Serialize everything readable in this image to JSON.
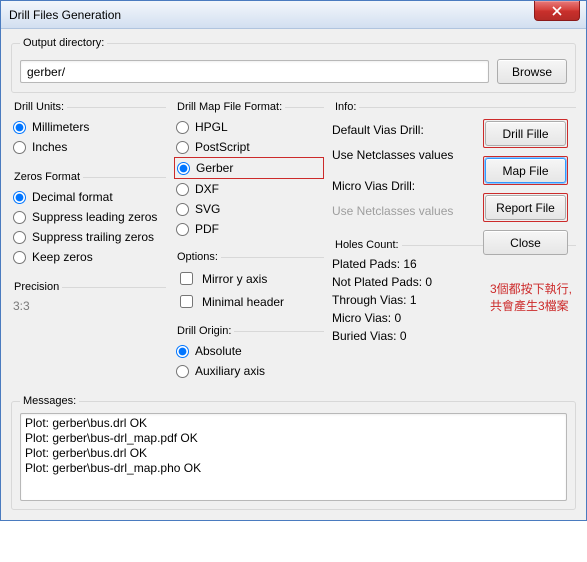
{
  "window": {
    "title": "Drill Files Generation"
  },
  "output": {
    "legend": "Output directory:",
    "value": "gerber/",
    "browse": "Browse"
  },
  "drillUnits": {
    "legend": "Drill Units:",
    "items": [
      "Millimeters",
      "Inches"
    ],
    "selected": 0
  },
  "zerosFormat": {
    "legend": "Zeros Format",
    "items": [
      "Decimal format",
      "Suppress leading zeros",
      "Suppress trailing zeros",
      "Keep zeros"
    ],
    "selected": 0
  },
  "precision": {
    "legend": "Precision",
    "value": "3:3"
  },
  "mapFormat": {
    "legend": "Drill Map File Format:",
    "items": [
      "HPGL",
      "PostScript",
      "Gerber",
      "DXF",
      "SVG",
      "PDF"
    ],
    "selected": 2
  },
  "options": {
    "legend": "Options:",
    "mirror": "Mirror y axis",
    "minhead": "Minimal header"
  },
  "drillOrigin": {
    "legend": "Drill Origin:",
    "items": [
      "Absolute",
      "Auxiliary axis"
    ],
    "selected": 0
  },
  "info": {
    "legend": "Info:",
    "defaultVias": "Default Vias Drill:",
    "useNetclasses": "Use Netclasses values",
    "microVias": "Micro Vias Drill:",
    "useNetclassesMuted": "Use Netclasses values",
    "holesLegend": "Holes Count:",
    "holes": {
      "plated": "Plated Pads: 16",
      "notPlated": "Not Plated Pads: 0",
      "through": "Through Vias: 1",
      "micro": "Micro Vias: 0",
      "buried": "Buried Vias: 0"
    }
  },
  "buttons": {
    "drill": "Drill Fille",
    "map": "Map File",
    "report": "Report File",
    "close": "Close"
  },
  "annotation": {
    "l1": "3個都按下執行,",
    "l2": "共會產生3檔案"
  },
  "messages": {
    "legend": "Messages:",
    "lines": [
      "Plot: gerber\\bus.drl OK",
      "Plot: gerber\\bus-drl_map.pdf OK",
      "Plot: gerber\\bus.drl OK",
      "Plot: gerber\\bus-drl_map.pho OK"
    ]
  }
}
